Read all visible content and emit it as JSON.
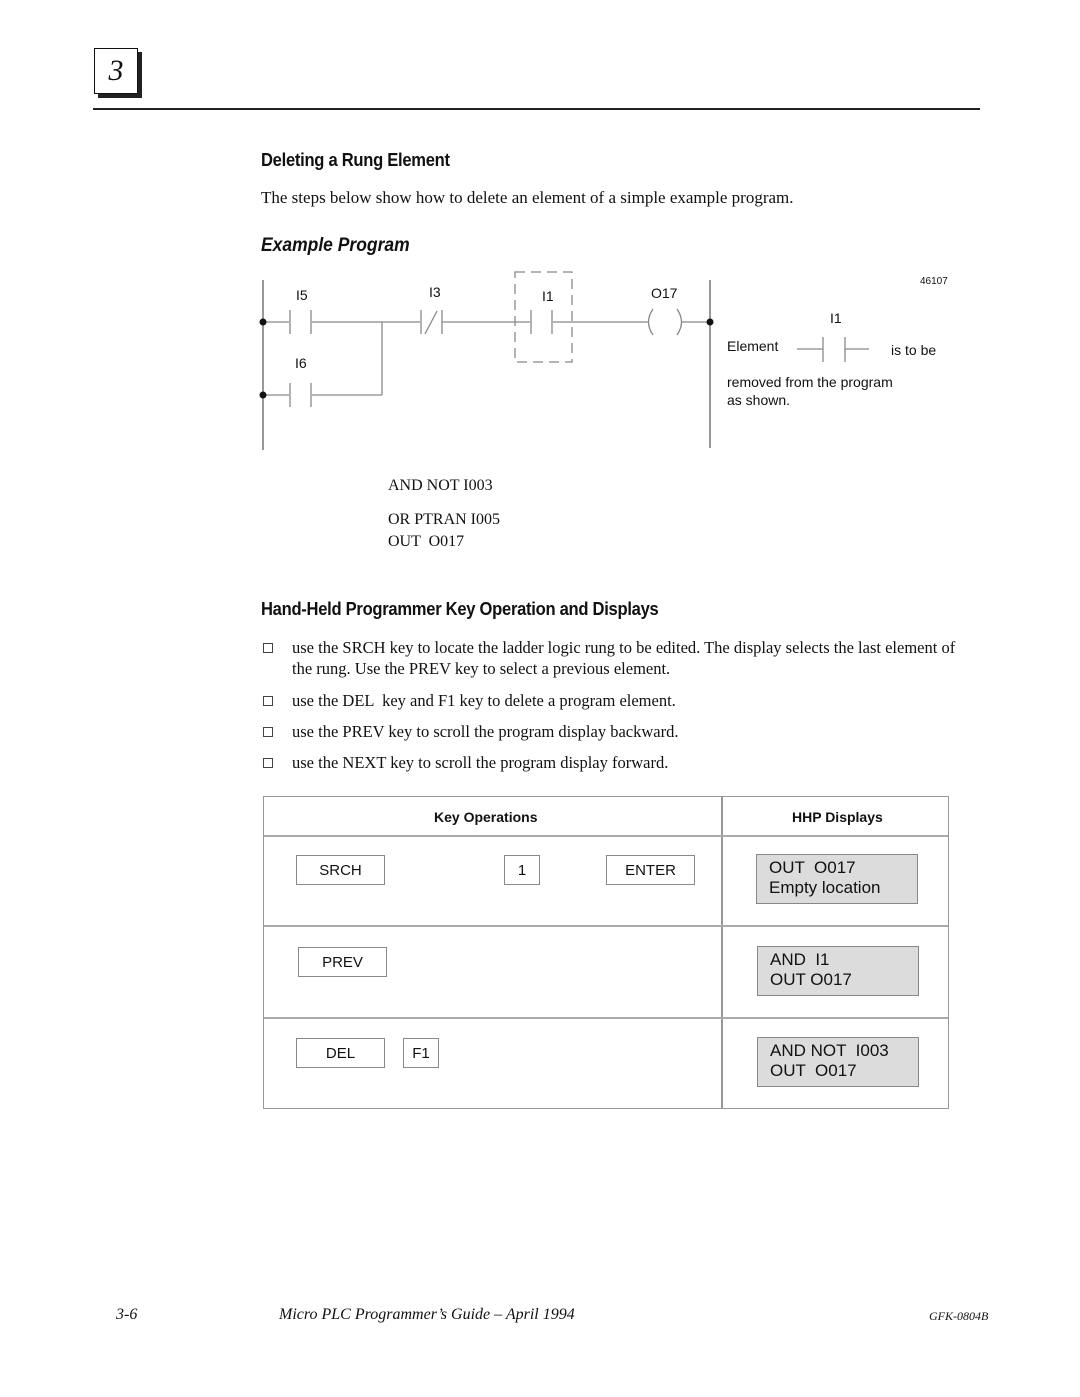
{
  "chapter": {
    "number": "3"
  },
  "section1": {
    "title": "Deleting a Rung Element",
    "intro": "The steps below show how to delete an element of a simple example program."
  },
  "example": {
    "title": "Example Program",
    "figure_id": "46107",
    "ladder": {
      "contacts": [
        {
          "label": "I5",
          "type": "normally-open"
        },
        {
          "label": "I6",
          "type": "normally-open"
        },
        {
          "label": "I3",
          "type": "normally-closed"
        },
        {
          "label": "I1",
          "type": "normally-open",
          "highlighted": true
        }
      ],
      "coil": {
        "label": "O17"
      }
    },
    "note": {
      "prefix": "Element",
      "element_label": "I1",
      "suffix": "is to be",
      "line2": "removed from the program",
      "line3": "as shown."
    },
    "statement_list": [
      "AND NOT I003",
      "OR PTRAN I005",
      "OUT  O017"
    ]
  },
  "section2": {
    "title": "Hand-Held Programmer Key Operation and Displays",
    "bullets": [
      "use the SRCH key to locate the ladder logic rung to be edited. The display selects the last element of the rung. Use the PREV key to select a previous element.",
      "use the DEL  key and F1 key to delete a program element.",
      "use the PREV key to scroll the program display backward.",
      "use the NEXT key to scroll the program display forward."
    ]
  },
  "table": {
    "headers": [
      "Key Operations",
      "HHP Displays"
    ],
    "rows": [
      {
        "keys": [
          "SRCH",
          "1",
          "ENTER"
        ],
        "display": "OUT  O017\nEmpty location"
      },
      {
        "keys": [
          "PREV"
        ],
        "display": "AND  I1\nOUT O017"
      },
      {
        "keys": [
          "DEL",
          "F1"
        ],
        "display": "AND NOT  I003\nOUT  O017"
      }
    ]
  },
  "footer": {
    "page": "3-6",
    "title": "Micro PLC Programmer’s Guide – April 1994",
    "doc_id": "GFK-0804B"
  }
}
